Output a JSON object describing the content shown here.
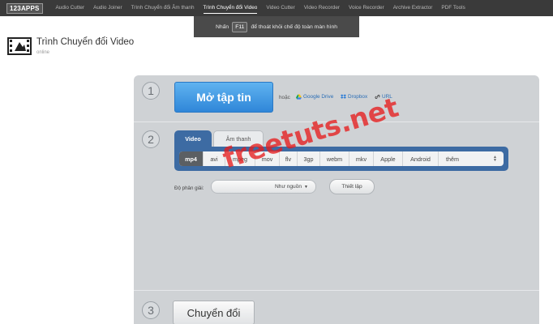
{
  "topbar": {
    "logo": "123APPS",
    "nav": [
      {
        "label": "Audio Cutter",
        "active": false
      },
      {
        "label": "Audio Joiner",
        "active": false
      },
      {
        "label": "Trình Chuyển đổi Âm thanh",
        "active": false
      },
      {
        "label": "Trình Chuyển đổi Video",
        "active": true
      },
      {
        "label": "Video Cutter",
        "active": false
      },
      {
        "label": "Video Recorder",
        "active": false
      },
      {
        "label": "Voice Recorder",
        "active": false
      },
      {
        "label": "Archive Extractor",
        "active": false
      },
      {
        "label": "PDF Tools",
        "active": false
      }
    ]
  },
  "fullscreen_tip": {
    "before": "Nhấn",
    "key": "F11",
    "after": "để thoát khỏi chế độ toàn màn hình"
  },
  "app": {
    "title": "Trình Chuyển đổi Video",
    "subtitle": "online"
  },
  "step1": {
    "number": "1",
    "open_button": "Mở tập tin",
    "or_text": "hoặc",
    "sources": [
      {
        "label": "Google Drive",
        "icon": "google-drive-icon"
      },
      {
        "label": "Dropbox",
        "icon": "dropbox-icon"
      },
      {
        "label": "URL",
        "icon": "link-icon"
      }
    ]
  },
  "step2": {
    "number": "2",
    "tabs": {
      "video": "Video",
      "audio": "Âm thanh"
    },
    "formats": [
      "mp4",
      "avi",
      "mpeg",
      "mov",
      "flv",
      "3gp",
      "webm",
      "mkv",
      "Apple",
      "Android"
    ],
    "more_label": "thêm",
    "selected_format": "mp4",
    "resolution_label": "Độ phân giải:",
    "resolution_value": "Như nguồn",
    "settings_button": "Thiết lập"
  },
  "step3": {
    "number": "3",
    "convert_button": "Chuyển đổi"
  },
  "watermark": "freetuts.net",
  "colors": {
    "topbar": "#3a3a3a",
    "primary_button": "#2f86d8",
    "tab_active": "#3d6ba3",
    "panel": "#cfd2d5",
    "watermark": "#e61e1e"
  }
}
